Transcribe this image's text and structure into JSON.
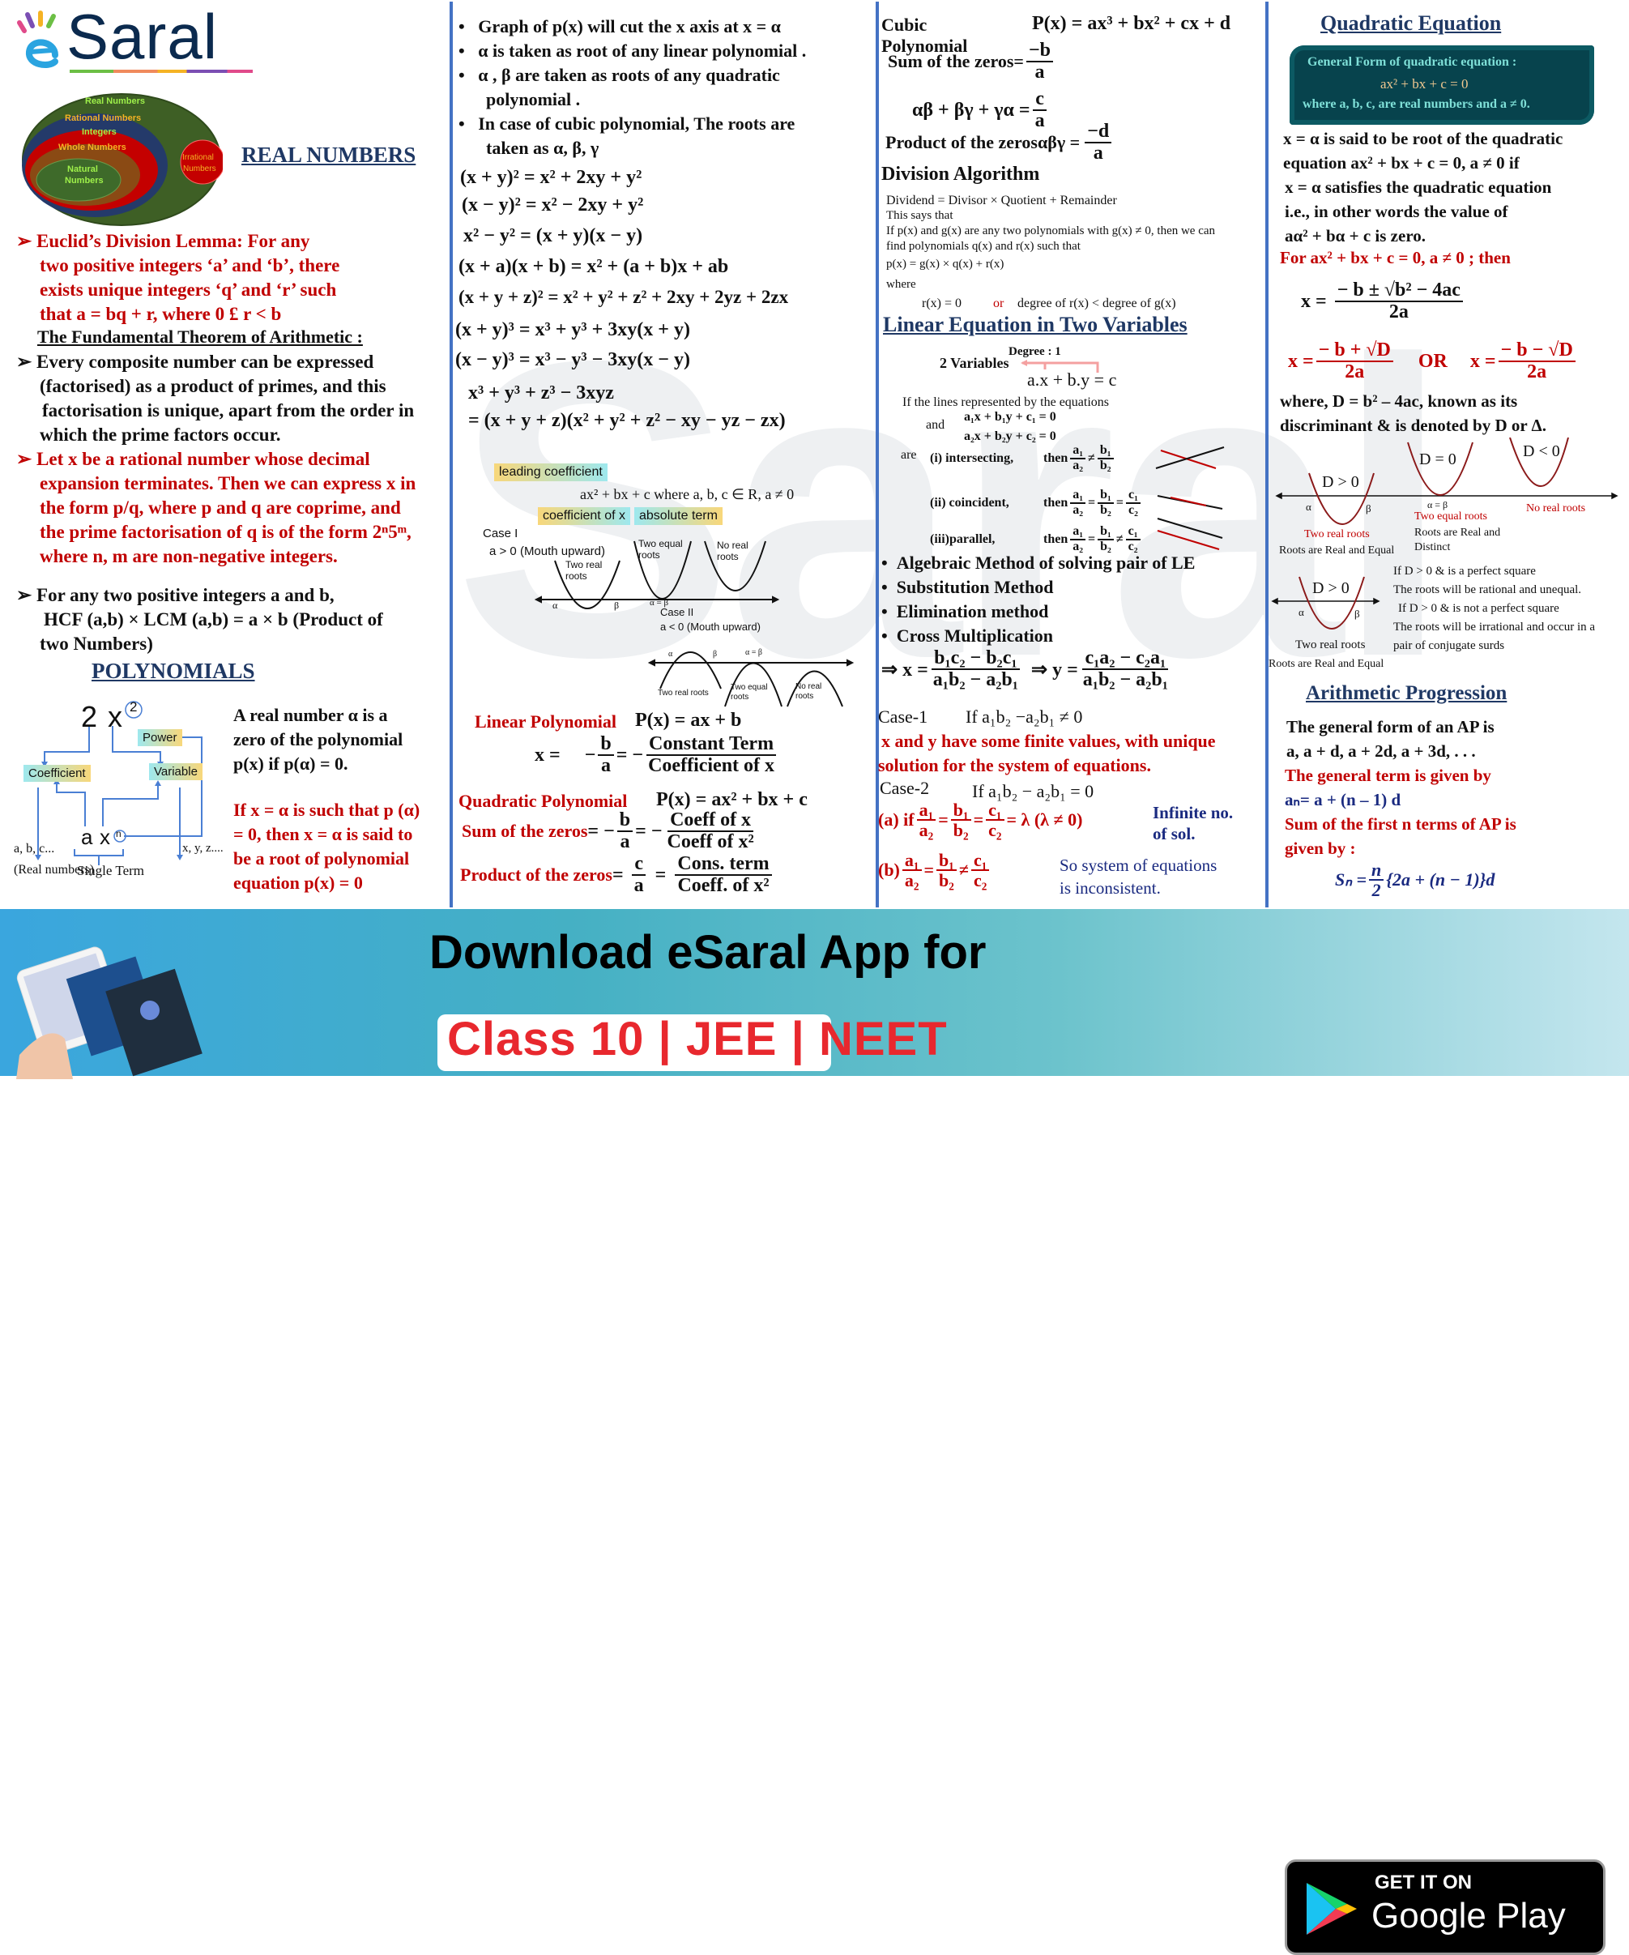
{
  "logo": {
    "text": "Saral",
    "prefix": "e"
  },
  "col1": {
    "venn": {
      "real": "Real Numbers",
      "rational": "Rational Numbers",
      "integers": "Integers",
      "whole": "Whole Numbers",
      "natural_1": "Natural",
      "natural_2": "Numbers",
      "irrational_1": "Irrational",
      "irrational_2": "Numbers"
    },
    "real_numbers_heading": "REAL NUMBERS",
    "euclid": [
      "Euclid’s Division Lemma: For any",
      "two positive integers ‘a’ and ‘b’, there",
      "exists unique integers ‘q’ and ‘r’ such",
      "that a = bq + r, where 0 £ r < b"
    ],
    "fta_heading": "The Fundamental Theorem of Arithmetic :",
    "fta": [
      "Every composite number can be expressed",
      "(factorised) as a product of primes, and this",
      "factorisation is unique, apart from the order in",
      "which the prime factors occur."
    ],
    "rational": [
      "Let x be a rational number whose decimal",
      "expansion terminates. Then we can express x in",
      "the form p/q, where p and q are coprime, and",
      "the prime factorisation of q is of the form 2ⁿ5ᵐ,",
      "where n, m are non-negative integers."
    ],
    "hcf": [
      "For any two positive integers a and b,",
      "HCF (a,b) × LCM (a,b) = a × b (Product of",
      "two Numbers)"
    ],
    "polynomials_heading": "POLYNOMIALS",
    "term_diagram": {
      "coef": "2",
      "var": "x",
      "pow": "2",
      "power_label": "Power",
      "coefficient_label": "Coefficient",
      "variable_label": "Variable",
      "generic_a": "a",
      "generic_x": "x",
      "generic_n": "n",
      "single_term": "Single Term",
      "abc": "a, b, c...",
      "real_numbers": "(Real numbers)",
      "xyz": "x, y, z...."
    },
    "zero_def": [
      "A real number α is a",
      "zero of the polynomial",
      "p(x) if p(α) = 0."
    ],
    "root_def": [
      "If x = α is such that p (α)",
      "= 0, then x = α  is said to",
      "be a root of polynomial",
      "equation p(x) = 0"
    ]
  },
  "col2": {
    "bullets": [
      "Graph of p(x) will cut the x axis at x = α",
      "α is taken as root of any  linear polynomial .",
      "α , β are taken as roots of any quadratic",
      "polynomial .",
      "In case of cubic polynomial, The roots are",
      "taken as α, β, γ"
    ],
    "identities": [
      "(x + y)² =  x² + 2xy + y²",
      "(x − y)² =  x² − 2xy + y²",
      "x² − y² =  (x + y)(x − y)",
      "(x + a)(x + b) = x² + (a + b)x + ab",
      "(x + y + z)² = x² + y² + z² + 2xy + 2yz + 2zx",
      "(x + y)³ =  x³ + y³ + 3xy(x + y)",
      "(x − y)³ =  x³ − y³ − 3xy(x − y)",
      "x³ + y³ + z³ − 3xyz",
      "= (x + y + z)(x² + y² + z² − xy − yz − zx)"
    ],
    "quad_form": {
      "leading": "leading coefficient",
      "expr": "ax² + bx + c   where  a, b, c ∈ R,  a ≠ 0",
      "coef_x": "coefficient of x",
      "absolute": "absolute term"
    },
    "case1": {
      "title": "Case I",
      "cond": "a > 0 (Mouth upward)",
      "two_real": [
        "Two real",
        "roots"
      ],
      "two_equal": [
        "Two equal",
        "roots"
      ],
      "no_real": [
        "No real",
        "roots"
      ],
      "alpha": "α",
      "beta": "β",
      "alpha_eq_beta": "α = β"
    },
    "case2": {
      "title": "Case II",
      "cond": "a < 0 (Mouth upward)",
      "two_real": "Two real roots",
      "two_equal": [
        "Two equal",
        "roots"
      ],
      "no_real": [
        "No real",
        "roots"
      ],
      "alpha": "α",
      "beta": "β",
      "alpha_eq_beta": "α = β"
    },
    "linear_label": "Linear Polynomial",
    "linear_expr": "P(x) = ax + b",
    "linear_x": "x =",
    "minus": "−",
    "b": "b",
    "a": "a",
    "eq_minus": "= −",
    "constant_term": "Constant Term",
    "coefficient_of_x": "Coefficient of x",
    "quadratic_label": "Quadratic Polynomial",
    "quadratic_expr": "P(x) = ax² + bx + c",
    "sum_label": "Sum of the zeros",
    "sum_eq": "= −",
    "coeff_of_x": "Coeff of  x",
    "coeff_of_x2": "Coeff of  x²",
    "product_label": "Product of the zeros",
    "product_eq": "=",
    "c": "c",
    "eq": "=",
    "cons_term": "Cons. term",
    "coeff_dot_x2": "Coeff. of  x²"
  },
  "col3": {
    "cubic_label_1": "Cubic",
    "cubic_label_2": "Polynomial",
    "cubic_expr": "P(x) = ax³ + bx² + cx + d",
    "sum_label": "Sum of the zeros=",
    "sum_num": "−b",
    "sum_den": "a",
    "pair_label": "αβ + βγ + γα =",
    "pair_num": "c",
    "pair_den": "a",
    "prod_label": "Product of the zerosαβγ  =",
    "prod_num": "−d",
    "prod_den": "a",
    "division_heading": "Division Algorithm",
    "division_lines": [
      "Dividend =  Divisor × Quotient + Remainder",
      "This says that",
      "If p(x) and g(x) are any two polynomials with g(x) ≠ 0, then we can",
      "find polynomials q(x) and r(x) such that",
      "p(x) =  g(x) × q(x) + r(x)",
      "where"
    ],
    "remainder_a": "r(x) =  0",
    "remainder_or": "or",
    "remainder_b": "degree of r(x) < degree of g(x)",
    "linear_heading": "Linear Equation in Two Variables",
    "degree": "Degree : 1",
    "two_variables": "2 Variables",
    "general_eq": "a.x + b.y = c",
    "lines_intro": "If the lines represented by the equations",
    "and": "and",
    "eq1": "a₁x + b₁y + c₁ = 0",
    "eq2": "a₂x + b₂y + c₂ = 0",
    "are": "are",
    "cases": [
      {
        "label": "(i) intersecting,",
        "then": "then",
        "ops": [
          "≠"
        ],
        "fracs": [
          [
            "a₁",
            "a₂"
          ],
          [
            "b₁",
            "b₂"
          ]
        ]
      },
      {
        "label": "(ii) coincident,",
        "then": "then",
        "ops": [
          "=",
          "="
        ],
        "fracs": [
          [
            "a₁",
            "a₂"
          ],
          [
            "b₁",
            "b₂"
          ],
          [
            "c₁",
            "c₂"
          ]
        ]
      },
      {
        "label": "(iii)parallel,",
        "then": "then",
        "ops": [
          "=",
          "≠"
        ],
        "fracs": [
          [
            "a₁",
            "a₂"
          ],
          [
            "b₁",
            "b₂"
          ],
          [
            "c₁",
            "c₂"
          ]
        ]
      }
    ],
    "methods": [
      "Algebraic Method of solving pair of LE",
      "Substitution Method",
      "Elimination method",
      "Cross Multiplication"
    ],
    "cross_x": "⇒  x =",
    "cross_x_num": "b₁c₂ − b₂c₁",
    "cross_den": "a₁b₂ − a₂b₁",
    "cross_y": "⇒ y =",
    "cross_y_num": "c₁a₂ − c₂a₁",
    "case1_label": "Case-1",
    "case1_cond": "If a₁b₂ −a₂b₁ ≠ 0",
    "case1_text": [
      "x and y have some finite values, with unique",
      "solution for the system of equations."
    ],
    "case2_label": "Case-2",
    "case2_cond": "If a₁b₂ − a₂b₁ = 0",
    "case_a_prefix": "(a) if",
    "case_a_suffix": "= λ (λ ≠ 0)",
    "case_a_result": [
      "Infinite no.",
      "of sol."
    ],
    "case_b_prefix": "(b)",
    "case_b_result": [
      "So system of equations",
      "is inconsistent."
    ]
  },
  "col4": {
    "heading": "Quadratic Equation",
    "box_line1": "General Form of quadratic equation :",
    "box_line2": "ax² + bx + c = 0",
    "box_line3": "where a, b, c, are real numbers and a ≠ 0.",
    "root_def": [
      "x = α is said to be root of the quadratic",
      "equation ax² + bx + c = 0, a ≠ 0 if",
      "x = α satisfies the quadratic equation",
      "i.e., in other words the value of",
      "aα² + bα + c is zero."
    ],
    "for_line": "For ax² + bx + c = 0, a ≠ 0 ; then",
    "formula_x": "x =",
    "formula_num": "− b ± √b² − 4ac",
    "formula_den": "2a",
    "plus_num": "− b + √D",
    "minus_num": "− b − √D",
    "or": "OR",
    "discriminant": [
      "where, D = b² – 4ac, known as its",
      "discriminant & is denoted by D or Δ."
    ],
    "graphs": {
      "d_pos": "D > 0",
      "d_zero": "D = 0",
      "d_neg": "D < 0",
      "alpha": "α",
      "beta": "β",
      "alpha_eq_beta": "α = β",
      "two_real": "Two real roots",
      "two_equal": "Two equal roots",
      "no_real": "No real roots",
      "real_equal": "Roots are Real and Equal",
      "real_distinct_1": "Roots are Real and",
      "real_distinct_2": "Distinct"
    },
    "perfect": [
      "If D > 0 & is a perfect square",
      "The roots will be rational and unequal.",
      "If D > 0 & is not a perfect square",
      "The roots will be irrational and occur in a",
      "pair of conjugate surds"
    ],
    "ap_heading": "Arithmetic Progression",
    "ap_lines": [
      "The general form of an AP is",
      "a, a + d, a + 2d, a + 3d, . . .",
      "The general term is given by",
      "aₙ= a + (n – 1) d",
      "Sum of the first n terms of AP is",
      "given by :"
    ],
    "sn_lhs": "Sₙ =",
    "sn_num": "n",
    "sn_den": "2",
    "sn_rhs": "{2a + (n − 1)}d"
  },
  "banner": {
    "title": "Download eSaral App for",
    "subtitle": "Class 10 | JEE | NEET",
    "gp_top": "GET IT ON",
    "gp_bottom": "Google Play"
  },
  "colors": {
    "divider": "#4472c4",
    "heading": "#1f3864",
    "emphasis": "#c00000"
  }
}
